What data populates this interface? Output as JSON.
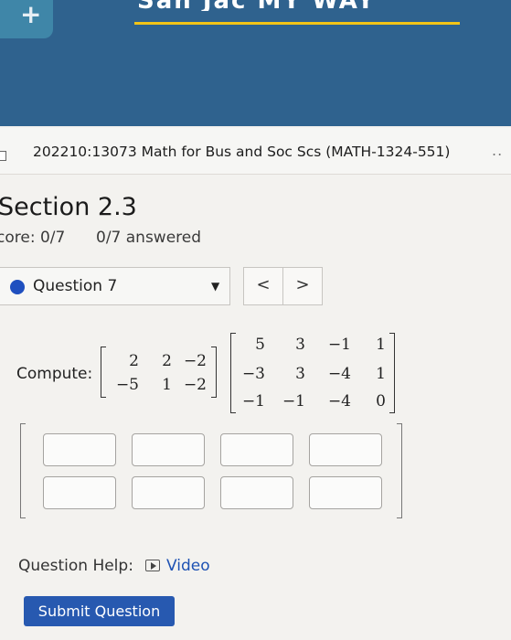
{
  "banner": {
    "title_fragment": "San Jac MY WAY",
    "plus_glyph": "+",
    "brand_color": "#2f628e",
    "accent_color": "#f2c417"
  },
  "course": {
    "title": "202210:13073 Math for Bus and Soc Scs (MATH-1324-551)",
    "more": ".."
  },
  "section": {
    "title": "Section 2.3",
    "score": "core: 0/7",
    "answered": "0/7 answered"
  },
  "question": {
    "label": "Question 7",
    "caret": "▼",
    "prev": "<",
    "next": ">"
  },
  "problem": {
    "label": "Compute:",
    "matrix_a": [
      [
        "2",
        "2",
        "−2"
      ],
      [
        "−5",
        "1",
        "−2"
      ]
    ],
    "matrix_b": [
      [
        "5",
        "3",
        "−1",
        "1"
      ],
      [
        "−3",
        "3",
        "−4",
        "1"
      ],
      [
        "−1",
        "−1",
        "−4",
        "0"
      ]
    ]
  },
  "answer_grid": {
    "rows": 2,
    "cols": 4
  },
  "help": {
    "label": "Question Help:",
    "video_icon": "play-video-icon",
    "video": "Video"
  },
  "submit": {
    "label": "Submit Question"
  }
}
